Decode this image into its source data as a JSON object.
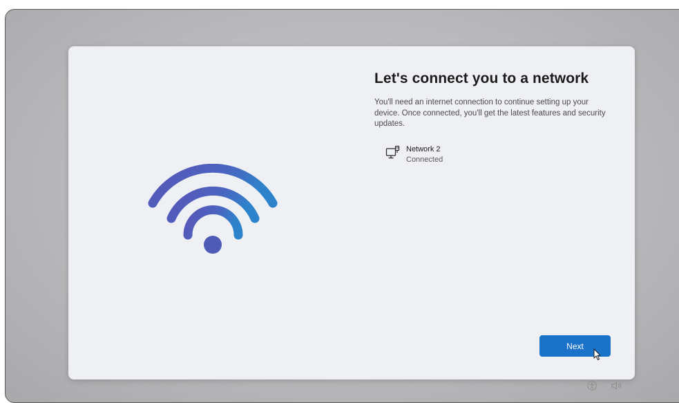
{
  "dialog": {
    "title": "Let's connect you to a network",
    "description": "You'll need an internet connection to continue setting up your device. Once connected, you'll get the latest features and security updates.",
    "illustration_icon": "wifi-icon"
  },
  "network": {
    "icon": "ethernet-computer-icon",
    "name": "Network 2",
    "status": "Connected"
  },
  "actions": {
    "next_label": "Next"
  },
  "tray": {
    "icons": [
      "accessibility-icon",
      "volume-icon"
    ]
  },
  "colors": {
    "accent": "#1a73c8",
    "wifi_gradient_start": "#5757b8",
    "wifi_gradient_end": "#2f7fc9",
    "dialog_background": "#eef0f3"
  }
}
